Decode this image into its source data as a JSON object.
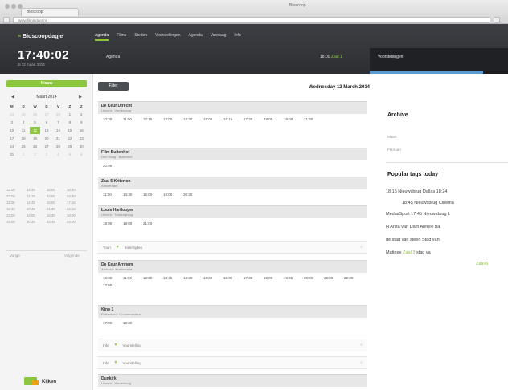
{
  "browser": {
    "tab_title": "Bioscoop",
    "window_title": "Bioscoop",
    "url": "www.filmladder.nl"
  },
  "header": {
    "logo_prefix": "≡",
    "logo_main": "Bioscoopdagje",
    "nav": [
      "Agenda",
      "Films",
      "Steden",
      "Voorstellingen",
      "Agenda",
      "Vandaag",
      "Info"
    ],
    "clock": "17:40:02",
    "clock_sub": "di 12 maart 2014",
    "label": "Agenda",
    "time_text": "18:00",
    "time_green": "Zaal 1",
    "right_label": "Voorstellingen",
    "progress": 0.82
  },
  "sidebar": {
    "new_button": "Nieuw",
    "calendar": {
      "prev": "◀",
      "next": "▶",
      "title": "Maart 2014",
      "dow": [
        "M",
        "D",
        "W",
        "D",
        "V",
        "Z",
        "Z"
      ],
      "days": [
        "24",
        "25",
        "26",
        "27",
        "28",
        "1",
        "2",
        "3",
        "4",
        "5",
        "6",
        "7",
        "8",
        "9",
        "10",
        "11",
        "12",
        "13",
        "14",
        "15",
        "16",
        "17",
        "18",
        "19",
        "20",
        "21",
        "22",
        "23",
        "24",
        "25",
        "26",
        "27",
        "28",
        "29",
        "30",
        "31",
        "1",
        "2",
        "3",
        "4",
        "5",
        "6"
      ],
      "today_index": 16
    },
    "table": [
      "12:00",
      "14:30",
      "16:00",
      "18:30",
      "20:00",
      "21:15",
      "22:00",
      "23:30",
      "11:00",
      "12:45",
      "15:00",
      "17:15",
      "19:30",
      "20:45",
      "21:30",
      "22:15",
      "13:00",
      "14:00",
      "16:30",
      "18:00",
      "19:00",
      "20:30",
      "22:45",
      "23:00"
    ],
    "link_left": "Vorige",
    "link_right": "Volgende",
    "logo_text": "Kijken"
  },
  "main": {
    "filter_button": "Filter",
    "date_title": "Wednesday 12 March 2014",
    "blocks": [
      {
        "title": "De Keur Utrecht",
        "sub": "Utrecht · Vredenburg",
        "times": [
          "10:30",
          "11:00",
          "12:15",
          "13:00",
          "14:30",
          "15:00",
          "16:15",
          "17:30",
          "18:00",
          "19:00",
          "21:30"
        ]
      },
      {
        "title": "Film Buitenhof",
        "sub": "Den Haag · Buitenhof",
        "times": [
          "20:00"
        ]
      },
      {
        "title": "Zaal 5 Kriterion",
        "sub": "Amsterdam",
        "times": [
          "11:00",
          "13:30",
          "15:00",
          "18:00",
          "20:30"
        ]
      },
      {
        "title": "Louis Hartlooper",
        "sub": "Utrecht · Tolsteegbrug",
        "times": [
          "18:00",
          "19:00",
          "21:00"
        ]
      }
    ],
    "divider1": {
      "label": "Toon",
      "center": "meer tijden",
      "right": "›"
    },
    "block5": {
      "title": "De Keur Arnhem",
      "sub": "Arnhem · Korenmarkt",
      "times": [
        "10:30",
        "11:00",
        "12:30",
        "13:45",
        "14:30",
        "16:00",
        "16:30",
        "17:30",
        "19:00",
        "19:45",
        "20:00",
        "22:00",
        "22:30",
        "23:00"
      ]
    },
    "block6": {
      "title": "Kino 1",
      "sub": "Rotterdam · Gouvernestraat",
      "times": [
        "17:00",
        "19:30"
      ]
    },
    "divider2": {
      "label": "Info",
      "center": "Voorstelling",
      "right": "›"
    },
    "divider3": {
      "label": "Info",
      "center": "Voorstelling",
      "right": "›"
    },
    "block7": {
      "title": "Dunkirk",
      "sub": "Utrecht · Vredenburg"
    }
  },
  "right": {
    "archive_title": "Archive",
    "archive_link1": "Maart",
    "archive_link2": "Februari",
    "popular_title": "Popular tags today",
    "lines": [
      {
        "text": "18:15 Nieuwsbrug Dallas  18:24"
      },
      {
        "text": "18:45 Nieuwsbrug Cinema"
      },
      {
        "text": "Media/Sport  17:45 Nieuwsbrug L"
      },
      {
        "text": "H  Anita van Dam  Annele  ba"
      },
      {
        "text": "de stad van steen  Stad van"
      },
      {
        "text": "Matinee",
        "green": "Zaal 3",
        "tail": "stad va"
      },
      {
        "text": "",
        "green": "Zaal 6",
        "tail": ""
      }
    ]
  }
}
